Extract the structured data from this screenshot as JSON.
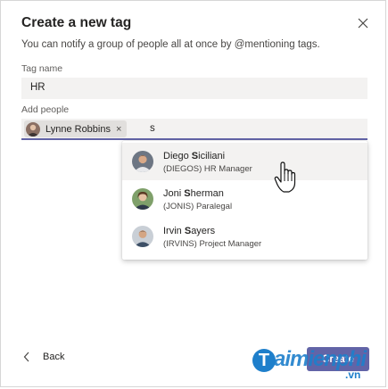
{
  "dialog": {
    "title": "Create a new tag",
    "subtitle": "You can notify a group of people all at once by @mentioning tags."
  },
  "tag_name": {
    "label": "Tag name",
    "value": "HR"
  },
  "add_people": {
    "label": "Add people",
    "selected": [
      {
        "name": "Lynne Robbins",
        "remove": "×"
      }
    ],
    "query": "s"
  },
  "suggestions": [
    {
      "pre": "Diego ",
      "match": "S",
      "post": "iciliani",
      "detail": "(DIEGOS) HR Manager",
      "highlighted": true
    },
    {
      "pre": "Joni ",
      "match": "S",
      "post": "herman",
      "detail": "(JONIS) Paralegal",
      "highlighted": false
    },
    {
      "pre": "Irvin ",
      "match": "S",
      "post": "ayers",
      "detail": "(IRVINS) Project Manager",
      "highlighted": false
    }
  ],
  "footer": {
    "back": "Back",
    "create": "Create"
  },
  "watermark": {
    "mark": "T",
    "text": "aimienphi",
    "domain": ".vn"
  },
  "colors": {
    "accent": "#6264a7",
    "field_bg": "#f3f2f1",
    "watermark": "#1e7fcb"
  }
}
